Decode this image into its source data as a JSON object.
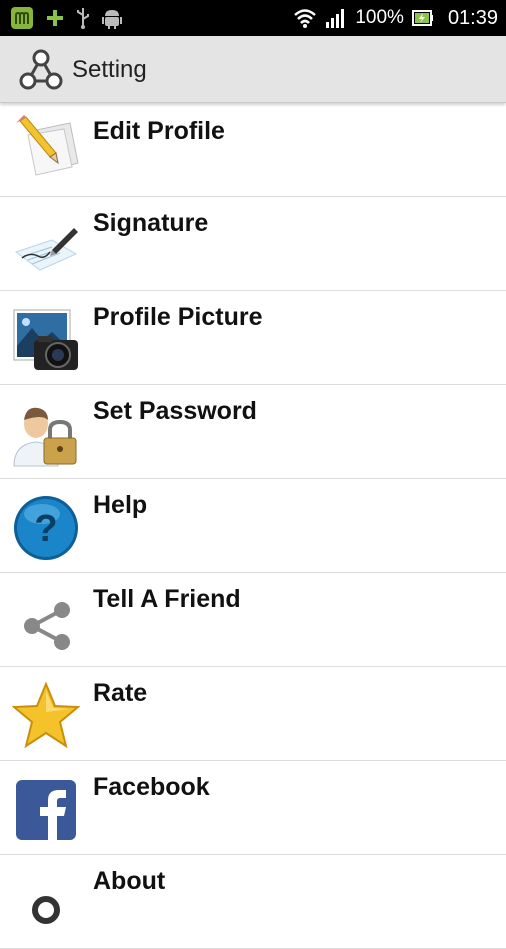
{
  "status_bar": {
    "battery": "100%",
    "time": "01:39",
    "icons": [
      "m-app-icon",
      "plus-icon",
      "usb-icon",
      "android-icon",
      "wifi-icon",
      "signal-icon",
      "battery-icon"
    ]
  },
  "action_bar": {
    "title": "Setting",
    "logo_icon": "share-network-logo-icon"
  },
  "menu": {
    "items": [
      {
        "label": "Edit Profile",
        "icon": "edit-pencil-icon"
      },
      {
        "label": "Signature",
        "icon": "signature-pen-icon"
      },
      {
        "label": "Profile Picture",
        "icon": "camera-picture-icon"
      },
      {
        "label": "Set Password",
        "icon": "user-lock-icon"
      },
      {
        "label": "Help",
        "icon": "help-question-icon"
      },
      {
        "label": "Tell A Friend",
        "icon": "share-icon"
      },
      {
        "label": "Rate",
        "icon": "star-icon"
      },
      {
        "label": "Facebook",
        "icon": "facebook-icon"
      },
      {
        "label": "About",
        "icon": "about-icon"
      }
    ]
  },
  "colors": {
    "statusbar": "#000000",
    "actionbar": "#e4e4e4",
    "accent_green": "#8bc34a",
    "help_blue": "#1577b8",
    "star_yellow": "#f4c22b",
    "facebook_blue": "#3b5998"
  }
}
